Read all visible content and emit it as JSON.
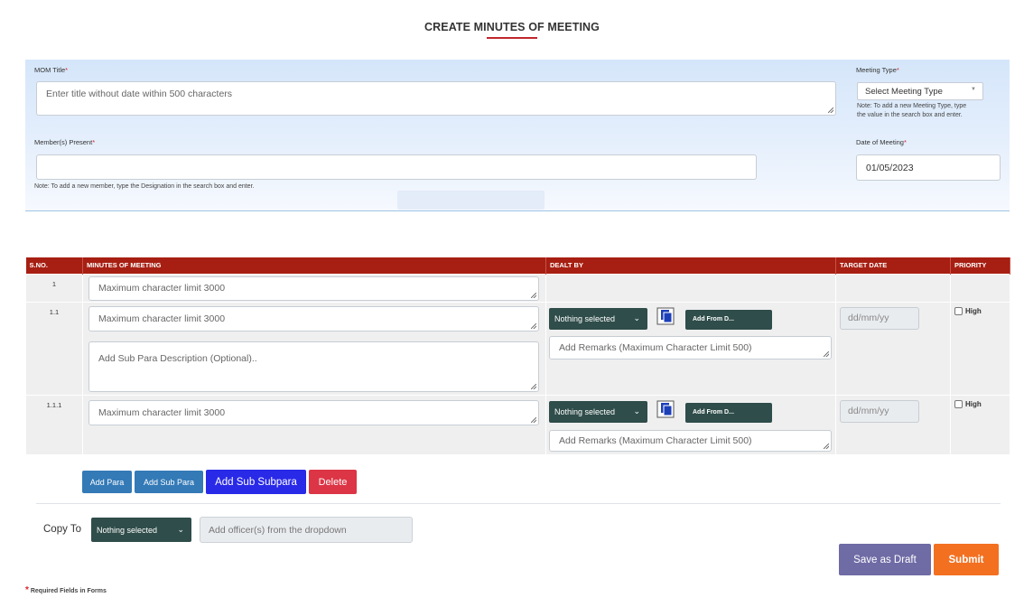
{
  "page": {
    "title": "CREATE MINUTES OF MEETING",
    "accent_color": "#c0282d"
  },
  "form": {
    "mom_title": {
      "label": "MOM Title",
      "required_mark": "*",
      "placeholder": "Enter title without date within 500 characters"
    },
    "meeting_type": {
      "label": "Meeting Type",
      "required_mark": "*",
      "selected": "Select Meeting Type",
      "note_line1": "Note: To add a new Meeting Type, type",
      "note_line2": "the value in the search box and enter."
    },
    "members_present": {
      "label": "Member(s) Present",
      "required_mark": "*",
      "value": "",
      "note": "Note: To add a new member, type the Designation in the search box and enter."
    },
    "date_of_meeting": {
      "label": "Date of Meeting",
      "required_mark": "*",
      "value": "01/05/2023"
    }
  },
  "table": {
    "header_color": "#a71f12",
    "columns": [
      "S.NO.",
      "MINUTES OF MEETING",
      "DEALT BY",
      "TARGET DATE",
      "PRIORITY"
    ],
    "rows": [
      {
        "sno": "1",
        "minutes_placeholder": "Maximum character limit 3000"
      },
      {
        "sno": "1.1",
        "minutes_placeholder": "Maximum character limit 3000",
        "description_placeholder": "Add Sub Para Description (Optional)..",
        "dealt_by": "Nothing selected",
        "add_from": "Add From D...",
        "remarks_placeholder": "Add Remarks (Maximum Character Limit 500)",
        "target_date_placeholder": "dd/mm/yy",
        "priority_label": "High"
      },
      {
        "sno": "1.1.1",
        "minutes_placeholder": "Maximum character limit 3000",
        "dealt_by": "Nothing selected",
        "add_from": "Add From D...",
        "remarks_placeholder": "Add Remarks (Maximum Character Limit 500)",
        "target_date_placeholder": "dd/mm/yy",
        "priority_label": "High"
      }
    ]
  },
  "actions": {
    "add_para": "Add Para",
    "add_sub_para": "Add Sub Para",
    "add_sub_subpara": "Add Sub Subpara",
    "delete": "Delete",
    "colors": {
      "add_para": "#337ab7",
      "add_sub_subpara": "#2929e8",
      "delete": "#dc3545"
    }
  },
  "copy_to": {
    "label": "Copy To",
    "selected": "Nothing selected",
    "officer_placeholder": "Add officer(s) from the dropdown"
  },
  "footer": {
    "save_draft": "Save as Draft",
    "submit": "Submit",
    "required_mark": "*",
    "required_note": "Required Fields in Forms",
    "colors": {
      "save_draft": "#6f6ba5",
      "submit": "#f37021"
    }
  }
}
